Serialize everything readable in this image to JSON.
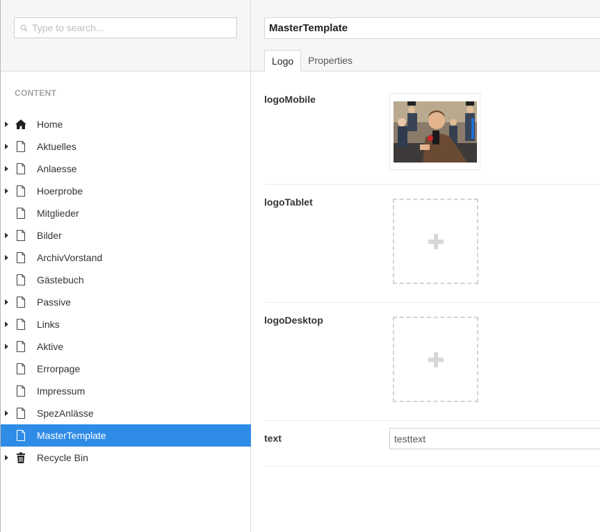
{
  "search": {
    "placeholder": "Type to search..."
  },
  "sidebar": {
    "section_title": "CONTENT",
    "items": [
      {
        "label": "Home",
        "icon": "home-icon",
        "expandable": true
      },
      {
        "label": "Aktuelles",
        "icon": "document-icon",
        "expandable": true
      },
      {
        "label": "Anlaesse",
        "icon": "document-icon",
        "expandable": true
      },
      {
        "label": "Hoerprobe",
        "icon": "document-icon",
        "expandable": true
      },
      {
        "label": "Mitglieder",
        "icon": "document-icon",
        "expandable": false
      },
      {
        "label": "Bilder",
        "icon": "document-icon",
        "expandable": true
      },
      {
        "label": "ArchivVorstand",
        "icon": "document-icon",
        "expandable": true
      },
      {
        "label": "Gästebuch",
        "icon": "document-icon",
        "expandable": false
      },
      {
        "label": "Passive",
        "icon": "document-icon",
        "expandable": true
      },
      {
        "label": "Links",
        "icon": "document-icon",
        "expandable": true
      },
      {
        "label": "Aktive",
        "icon": "document-icon",
        "expandable": true
      },
      {
        "label": "Errorpage",
        "icon": "document-icon",
        "expandable": false
      },
      {
        "label": "Impressum",
        "icon": "document-icon",
        "expandable": false
      },
      {
        "label": "SpezAnlässe",
        "icon": "document-icon",
        "expandable": true
      },
      {
        "label": "MasterTemplate",
        "icon": "document-icon",
        "expandable": false,
        "selected": true
      },
      {
        "label": "Recycle Bin",
        "icon": "trash-icon",
        "expandable": true
      }
    ]
  },
  "editor": {
    "node_name": "MasterTemplate",
    "tabs": [
      {
        "label": "Logo",
        "active": true
      },
      {
        "label": "Properties",
        "active": false
      }
    ],
    "properties": {
      "logo_mobile": {
        "label": "logoMobile",
        "has_image": true
      },
      "logo_tablet": {
        "label": "logoTablet",
        "has_image": false
      },
      "logo_desktop": {
        "label": "logoDesktop",
        "has_image": false
      },
      "text": {
        "label": "text",
        "value": "testtext"
      }
    }
  },
  "colors": {
    "selected_bg": "#2e8ce6",
    "header_bg": "#f6f6f6",
    "muted_text": "#a3a3a3"
  }
}
